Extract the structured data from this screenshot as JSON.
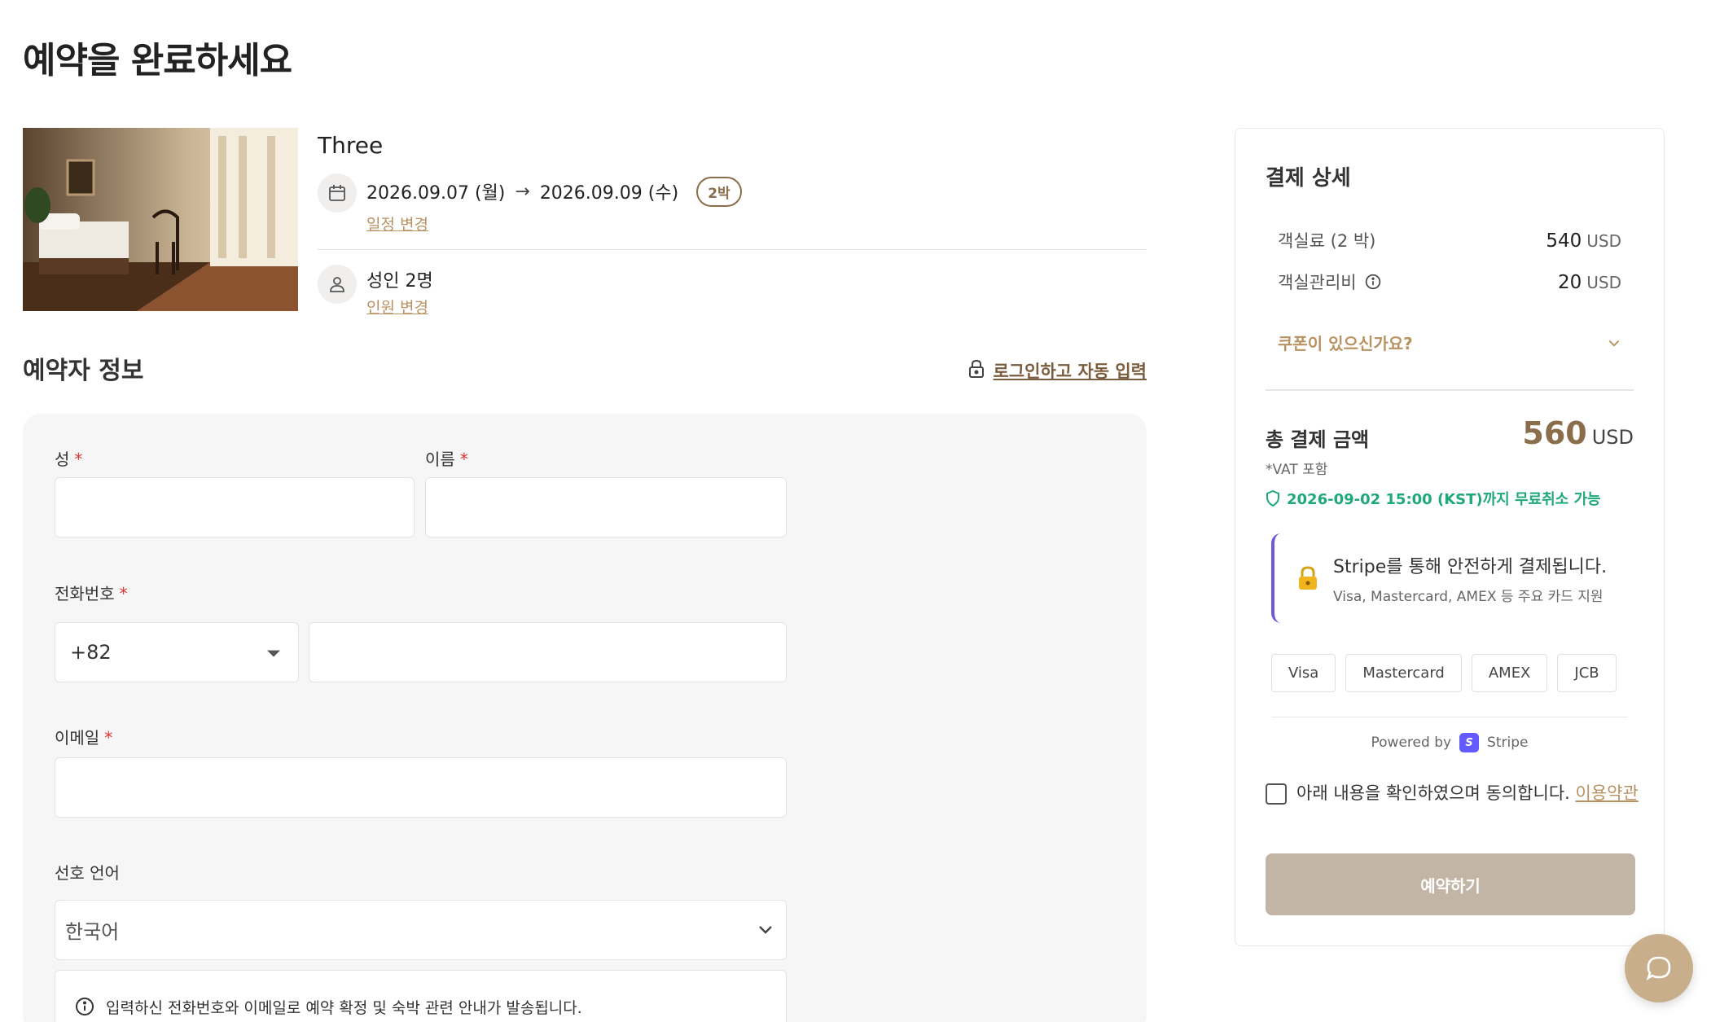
{
  "page": {
    "title": "예약을 완료하세요"
  },
  "room": {
    "name": "Three",
    "checkin": "2026.09.07 (월)",
    "arrow": "→",
    "checkout": "2026.09.09 (수)",
    "nights": "2박",
    "change_dates": "일정 변경",
    "guests": "성인 2명",
    "change_guests": "인원 변경"
  },
  "booker": {
    "section_title": "예약자 정보",
    "login_autofill": "로그인하고 자동 입력",
    "last_name_label": "성",
    "first_name_label": "이름",
    "required_mark": "*",
    "last_name_value": "",
    "first_name_value": "",
    "phone_label": "전화번호",
    "country_code": "+82",
    "phone_value": "",
    "email_label": "이메일",
    "email_value": "",
    "language_label": "선호 언어",
    "language_value": "한국어",
    "notice": "입력하신 전화번호와 이메일로 예약 확정 및 숙박 관련 안내가 발송됩니다."
  },
  "payment": {
    "title": "결제 상세",
    "room_fee_label": "객실료 (2 박)",
    "room_fee_value": "540",
    "mgmt_fee_label": "객실관리비",
    "mgmt_fee_value": "20",
    "currency": "USD",
    "coupon": "쿠폰이 있으신가요?",
    "total_label": "총 결제 금액",
    "total_value": "560",
    "vat": "*VAT 포함",
    "free_cancel": "2026-09-02 15:00 (KST)까지 무료취소 가능",
    "stripe_main": "Stripe를 통해 안전하게 결제됩니다.",
    "stripe_sub": "Visa, Mastercard, AMEX 등 주요 카드 지원",
    "brands": [
      "Visa",
      "Mastercard",
      "AMEX",
      "JCB"
    ],
    "powered_by": "Powered by",
    "stripe_name": "Stripe",
    "agree_text": "아래 내용을 확인하였으며 동의합니다.",
    "terms_link": "이용약관",
    "reserve_button": "예약하기"
  },
  "colors": {
    "accent_brown": "#8a6d4b",
    "link_gold": "#b89260",
    "green": "#1fa87a",
    "stripe_purple": "#635bff",
    "button_disabled": "#c3b5a5",
    "chat_fab": "#c9ae8c"
  },
  "icons": {
    "calendar": "calendar-icon",
    "person": "person-icon",
    "lock": "lock-icon",
    "info": "info-icon",
    "chevron": "chevron-down-icon",
    "shield": "shield-icon",
    "padlock": "padlock-emoji-icon",
    "chat": "chat-bubble-icon"
  }
}
